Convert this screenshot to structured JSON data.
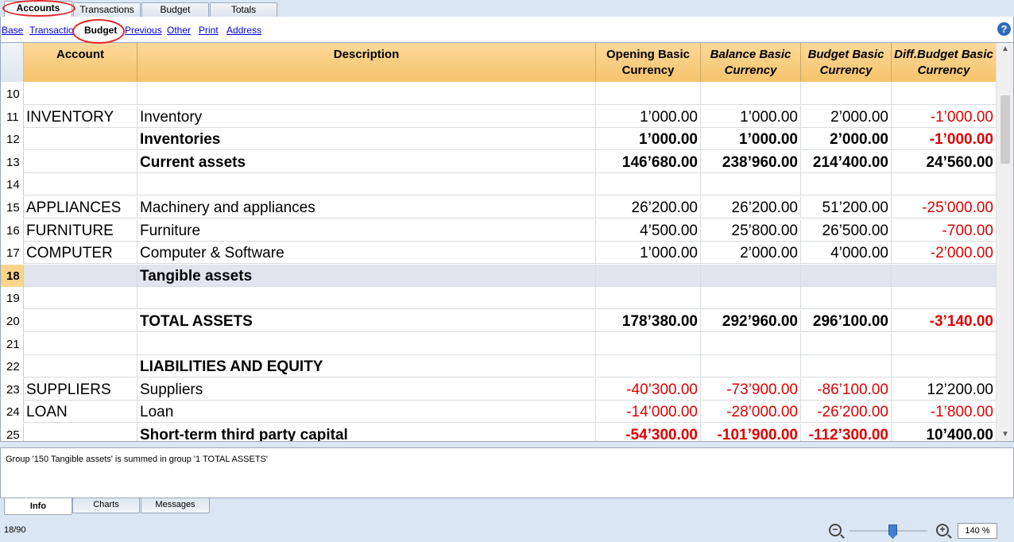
{
  "top_tabs": [
    {
      "label": "Accounts",
      "active": true
    },
    {
      "label": "Transactions",
      "active": false
    },
    {
      "label": "Budget",
      "active": false
    },
    {
      "label": "Totals",
      "active": false
    }
  ],
  "views": [
    {
      "label": "Base",
      "active": false
    },
    {
      "label": "Transaction",
      "active": false
    },
    {
      "label": "Budget",
      "active": true
    },
    {
      "label": "Previous",
      "active": false
    },
    {
      "label": "Other",
      "active": false
    },
    {
      "label": "Print",
      "active": false
    },
    {
      "label": "Address",
      "active": false
    }
  ],
  "help_label": "?",
  "columns": {
    "account": "Account",
    "description": "Description",
    "opening": "Opening Basic Currency",
    "balance": "Balance Basic Currency",
    "budget": "Budget Basic Currency",
    "diff": "Diff.Budget Basic Currency"
  },
  "rows": [
    {
      "n": "10",
      "account": "",
      "description": "",
      "opening": "",
      "balance": "",
      "budget": "",
      "diff": "",
      "bold": false
    },
    {
      "n": "11",
      "account": "INVENTORY",
      "description": "Inventory",
      "opening": "1’000.00",
      "balance": "1’000.00",
      "budget": "2’000.00",
      "diff": "-1’000.00",
      "bold": false
    },
    {
      "n": "12",
      "account": "",
      "description": "Inventories",
      "opening": "1’000.00",
      "balance": "1’000.00",
      "budget": "2’000.00",
      "diff": "-1’000.00",
      "bold": true
    },
    {
      "n": "13",
      "account": "",
      "description": "Current assets",
      "opening": "146’680.00",
      "balance": "238’960.00",
      "budget": "214’400.00",
      "diff": "24’560.00",
      "bold": true
    },
    {
      "n": "14",
      "account": "",
      "description": "",
      "opening": "",
      "balance": "",
      "budget": "",
      "diff": "",
      "bold": false
    },
    {
      "n": "15",
      "account": "APPLIANCES",
      "description": "Machinery and appliances",
      "opening": "26’200.00",
      "balance": "26’200.00",
      "budget": "51’200.00",
      "diff": "-25’000.00",
      "bold": false
    },
    {
      "n": "16",
      "account": "FURNITURE",
      "description": "Furniture",
      "opening": "4’500.00",
      "balance": "25’800.00",
      "budget": "26’500.00",
      "diff": "-700.00",
      "bold": false
    },
    {
      "n": "17",
      "account": "COMPUTER",
      "description": "Computer & Software",
      "opening": "1’000.00",
      "balance": "2’000.00",
      "budget": "4’000.00",
      "diff": "-2’000.00",
      "bold": false
    },
    {
      "n": "18",
      "account": "",
      "description": "Tangible assets",
      "opening": "",
      "balance": "",
      "budget": "",
      "diff": "",
      "bold": true,
      "selected": true
    },
    {
      "n": "19",
      "account": "",
      "description": "",
      "opening": "",
      "balance": "",
      "budget": "",
      "diff": "",
      "bold": false
    },
    {
      "n": "20",
      "account": "",
      "description": "TOTAL ASSETS",
      "opening": "178’380.00",
      "balance": "292’960.00",
      "budget": "296’100.00",
      "diff": "-3’140.00",
      "bold": true
    },
    {
      "n": "21",
      "account": "",
      "description": "",
      "opening": "",
      "balance": "",
      "budget": "",
      "diff": "",
      "bold": false
    },
    {
      "n": "22",
      "account": "",
      "description": "LIABILITIES AND EQUITY",
      "opening": "",
      "balance": "",
      "budget": "",
      "diff": "",
      "bold": true
    },
    {
      "n": "23",
      "account": "SUPPLIERS",
      "description": "Suppliers",
      "opening": "-40’300.00",
      "balance": "-73’900.00",
      "budget": "-86’100.00",
      "diff": "12’200.00",
      "bold": false
    },
    {
      "n": "24",
      "account": "LOAN",
      "description": "Loan",
      "opening": "-14’000.00",
      "balance": "-28’000.00",
      "budget": "-26’200.00",
      "diff": "-1’800.00",
      "bold": false
    },
    {
      "n": "25",
      "account": "",
      "description": "Short-term third party capital",
      "opening": "-54’300.00",
      "balance": "-101’900.00",
      "budget": "-112’300.00",
      "diff": "10’400.00",
      "bold": true
    }
  ],
  "info_message": "Group '150 Tangible assets' is summed in group '1 TOTAL ASSETS'",
  "bottom_tabs": [
    {
      "label": "Info",
      "active": true
    },
    {
      "label": "Charts",
      "active": false
    },
    {
      "label": "Messages",
      "active": false
    }
  ],
  "status": {
    "row_count": "18/90",
    "zoom": "140 %",
    "zoom_level_percent": 140
  },
  "colors": {
    "negative": "#e00000",
    "header_bg": "#f6c36b",
    "highlight_oval": "#e0262a",
    "selected_row": "#e2e4ee"
  }
}
